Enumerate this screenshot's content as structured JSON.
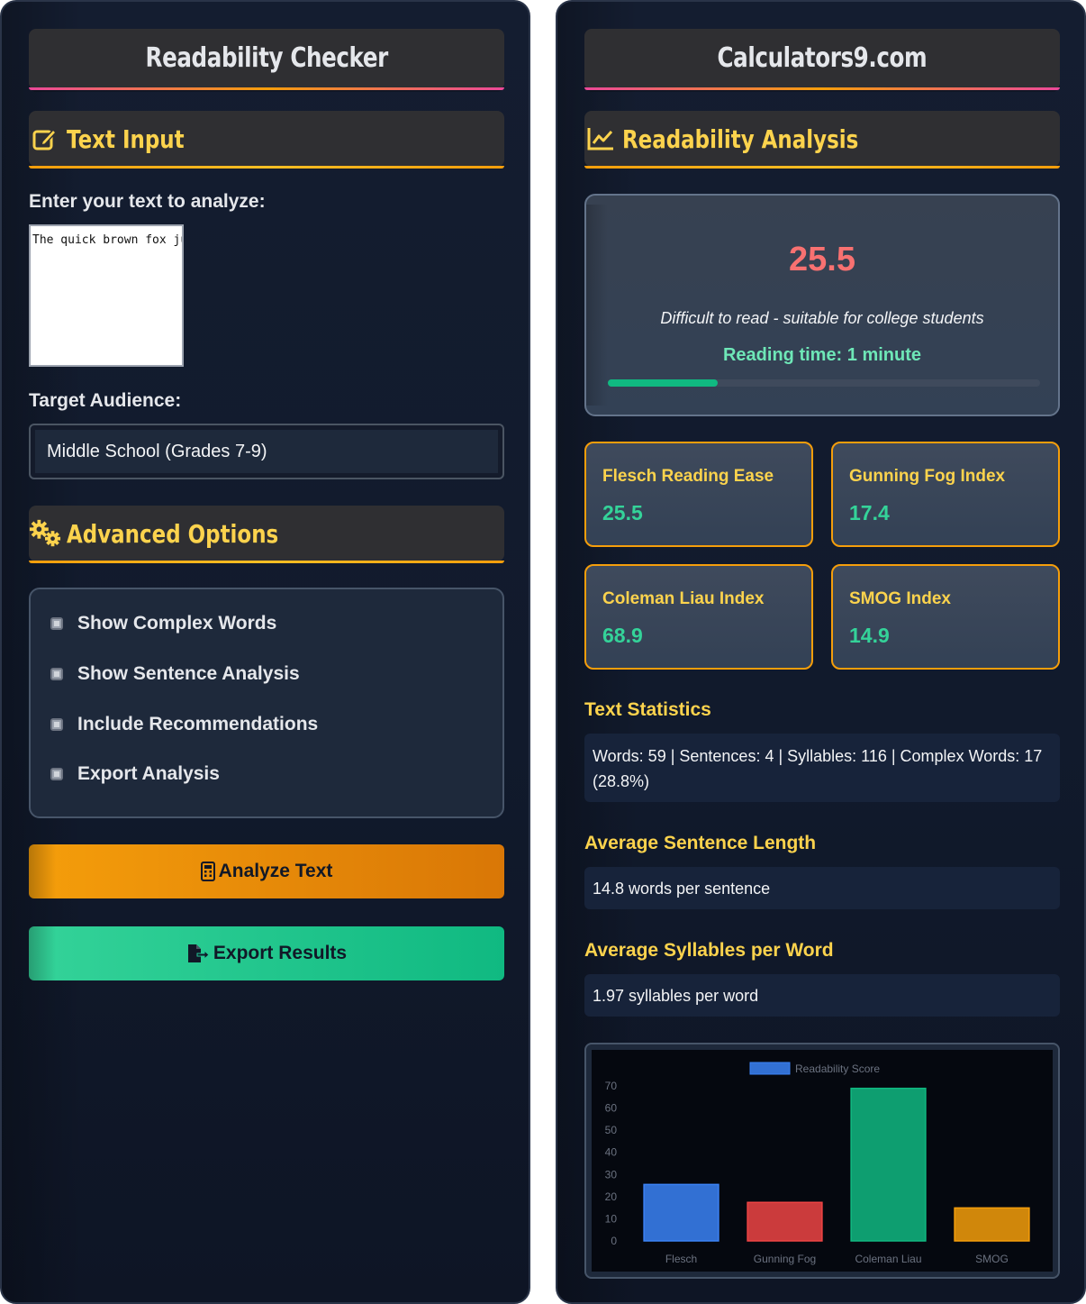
{
  "left": {
    "title": "Readability Checker",
    "text_input_heading": "Text Input",
    "text_label": "Enter your text to analyze:",
    "text_value": "The quick brown fox ju",
    "audience_label": "Target Audience:",
    "audience_value": "Middle School (Grades 7-9)",
    "advanced_heading": "Advanced Options",
    "options": [
      "Show Complex Words",
      "Show Sentence Analysis",
      "Include Recommendations",
      "Export Analysis"
    ],
    "analyze_label": "Analyze Text",
    "export_label": "Export Results"
  },
  "right": {
    "title": "Calculators9.com",
    "analysis_heading": "Readability Analysis",
    "score": "25.5",
    "score_description": "Difficult to read - suitable for college students",
    "reading_time": "Reading time: 1 minute",
    "score_progress_percent": 25.5,
    "metrics": [
      {
        "label": "Flesch Reading Ease",
        "value": "25.5"
      },
      {
        "label": "Gunning Fog Index",
        "value": "17.4"
      },
      {
        "label": "Coleman Liau Index",
        "value": "68.9"
      },
      {
        "label": "SMOG Index",
        "value": "14.9"
      }
    ],
    "text_stats_heading": "Text Statistics",
    "text_stats": "Words: 59 | Sentences: 4 | Syllables: 116 | Complex Words: 17 (28.8%)",
    "avg_sentence_heading": "Average Sentence Length",
    "avg_sentence": "14.8 words per sentence",
    "avg_syllables_heading": "Average Syllables per Word",
    "avg_syllables": "1.97 syllables per word"
  },
  "colors": {
    "accent_yellow": "#fcd34d",
    "score_red": "#f87171",
    "value_green": "#34d399",
    "analyze_orange": "#f59e0b",
    "export_green": "#10b981"
  },
  "icons": {
    "text_input": "edit-icon",
    "analysis": "chart-line-icon",
    "advanced": "gears-icon",
    "analyze": "calculator-icon",
    "export": "file-export-icon"
  },
  "chart_data": {
    "type": "bar",
    "categories": [
      "Flesch",
      "Gunning Fog",
      "Coleman Liau",
      "SMOG"
    ],
    "series": [
      {
        "name": "Readability Score",
        "values": [
          25.5,
          17.4,
          68.9,
          14.9
        ]
      }
    ],
    "bar_colors": [
      "#3b82f6",
      "#ef4444",
      "#10b981",
      "#f59e0b"
    ],
    "yticks": [
      0,
      10,
      20,
      30,
      40,
      50,
      60,
      70
    ],
    "ylim": [
      0,
      70
    ],
    "legend": "top",
    "grid": false
  }
}
